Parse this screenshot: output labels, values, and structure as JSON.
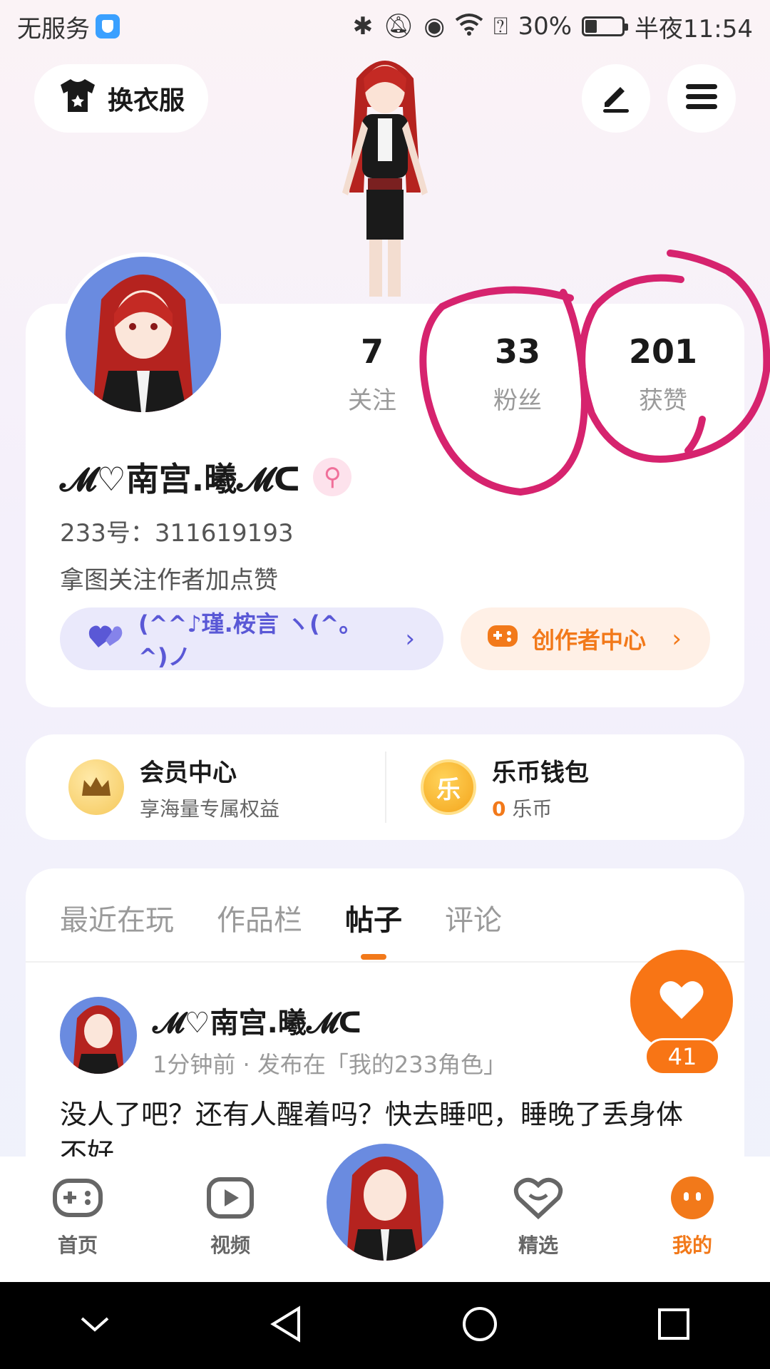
{
  "status_bar": {
    "carrier": "无服务",
    "battery_percent": "30%",
    "time": "半夜11:54"
  },
  "top": {
    "outfit_label": "换衣服"
  },
  "profile": {
    "stats": [
      {
        "num": "7",
        "label": "关注"
      },
      {
        "num": "33",
        "label": "粉丝"
      },
      {
        "num": "201",
        "label": "获赞"
      }
    ],
    "username": "𝓜♡南宫.曦𝓜ᑕ",
    "gender_symbol": "⚲",
    "uid": "233号：311619193",
    "bio": "拿图关注作者加点赞",
    "guild_label": "(^^♪瑾.桉言 ヽ(^。^)ノ",
    "creator_label": "创作者中心",
    "chevron": "›"
  },
  "member": {
    "vip_title": "会员中心",
    "vip_sub": "享海量专属权益",
    "wallet_title": "乐币钱包",
    "wallet_amount": "0",
    "wallet_unit": " 乐币",
    "coin_glyph": "乐"
  },
  "feed": {
    "tabs": [
      "最近在玩",
      "作品栏",
      "帖子",
      "评论"
    ],
    "active_tab": "帖子",
    "post": {
      "author": "𝓜♡南宫.曦𝓜ᑕ",
      "meta": "1分钟前 · 发布在「我的233角色」",
      "text": "没人了吧？还有人醒着吗？快去睡吧，睡晚了丢身体不好"
    },
    "like_count": "41"
  },
  "bottom_nav": [
    {
      "label": "首页",
      "icon": "gamepad-icon"
    },
    {
      "label": "视频",
      "icon": "video-icon"
    },
    {
      "label": "精选",
      "icon": "heart-chat-icon"
    },
    {
      "label": "我的",
      "icon": "me-face-icon"
    }
  ],
  "colors": {
    "accent": "#f2791a",
    "guild": "#5a58d6",
    "annotation": "#d6236e"
  }
}
